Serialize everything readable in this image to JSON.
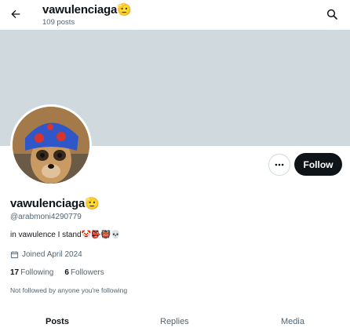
{
  "header": {
    "title": "vawulenciaga",
    "title_emoji": "🫡",
    "post_count": "109 posts",
    "back_icon": "arrow-left-icon",
    "search_icon": "search-icon"
  },
  "profile": {
    "display_name": "vawulenciaga",
    "name_emoji": "🫡",
    "handle": "@arabmoni4290779",
    "bio": "in vawulence I stand🤡👺👹💀",
    "joined": "Joined April 2024",
    "calendar_icon": "calendar-icon",
    "following_count": "17",
    "following_label": "Following",
    "followers_count": "6",
    "followers_label": "Followers",
    "not_followed_note": "Not followed by anyone you're following"
  },
  "actions": {
    "more_icon": "more-horizontal-icon",
    "follow_label": "Follow"
  },
  "tabs": [
    {
      "label": "Posts",
      "active": true
    },
    {
      "label": "Replies",
      "active": false
    },
    {
      "label": "Media",
      "active": false
    }
  ],
  "colors": {
    "banner": "#cfd9de",
    "text_primary": "#0f1419",
    "text_secondary": "#536471",
    "follow_button": "#0f1419"
  }
}
